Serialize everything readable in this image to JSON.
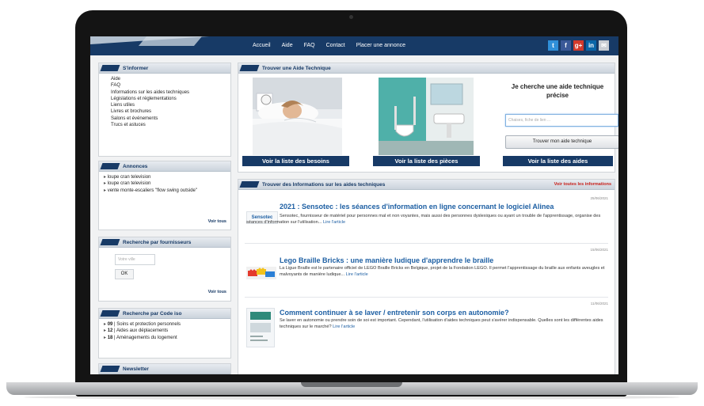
{
  "nav": [
    "Accueil",
    "Aide",
    "FAQ",
    "Contact",
    "Placer une annonce"
  ],
  "social_icons": [
    "twitter-icon",
    "facebook-icon",
    "google-plus-icon",
    "linkedin-icon",
    "mail-icon"
  ],
  "social_glyphs": [
    "t",
    "f",
    "g+",
    "in",
    "✉"
  ],
  "sidebar": {
    "informer": {
      "title": "S'informer",
      "links": [
        "Aide",
        "FAQ",
        "Informations sur les aides techniques",
        "Législations et réglementations",
        "Liens utiles",
        "Livres et brochures",
        "Salons et événements",
        "Trucs et astuces"
      ]
    },
    "annonces": {
      "title": "Annonces",
      "items": [
        "loupe cran television",
        "loupe cran television",
        "vente monte-escaliers \"flow swing outside\""
      ],
      "voir_tous": "Voir tous"
    },
    "fournisseurs": {
      "title": "Recherche par fournisseurs",
      "placeholder": "Votre ville",
      "ok": "OK",
      "voir_tous": "Voir tous"
    },
    "code_iso": {
      "title": "Recherche par Code iso",
      "items": [
        {
          "code": "09",
          "label": "Soins et protection personnels"
        },
        {
          "code": "12",
          "label": "Aides aux déplacements"
        },
        {
          "code": "18",
          "label": "Aménagements du logement"
        }
      ]
    },
    "newsletter": {
      "title": "Newsletter"
    }
  },
  "aide_technique": {
    "title": "Trouver une Aide Technique",
    "cards": [
      "Voir la liste des besoins",
      "Voir la liste des pièces",
      "Voir la liste des aides"
    ],
    "search_heading": "Je cherche une aide technique précise",
    "search_placeholder": "Chaises, fiche de lien ...",
    "search_button": "Trouver mon aide technique"
  },
  "informations": {
    "title": "Trouver des Informations sur les aides techniques",
    "voir_toutes": "Voir toutes les informations",
    "lire": "Lire l'article",
    "articles": [
      {
        "date": "25/06/2021",
        "thumb_text": "Sensotec",
        "title": "2021 : Sensotec : les séances d'information en ligne concernant le logiciel Alinea",
        "body": "Sensotec, fournisseur de matériel pour personnes mal et non voyantes, mais aussi des personnes dyslexiques ou ayant un trouble de l'apprentissage, organise des séances d'information sur l'utilisation..."
      },
      {
        "date": "15/06/2021",
        "thumb_text": "",
        "title": "Lego Braille Bricks : une manière ludique d'apprendre le braille",
        "body": "La Ligue Braille est le partenaire officiel de LEGO Braille Bricks en Belgique, projet de la Fondation LEGO. Il permet l'apprentissage du braille aux enfants aveugles et malvoyants de manière ludique..."
      },
      {
        "date": "11/06/2021",
        "thumb_text": "",
        "title": "Comment continuer à se laver / entretenir son corps en autonomie?",
        "body": "Se laver en autonomie ou prendre soin de soi est important. Cependant, l'utilisation d'aides techniques peut s'avérer indispensable. Quelles sont les différentes aides techniques sur le marché?"
      }
    ]
  }
}
